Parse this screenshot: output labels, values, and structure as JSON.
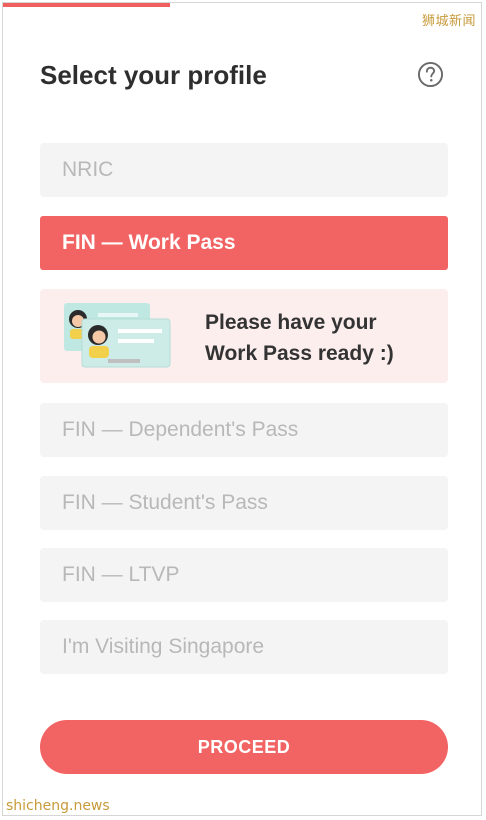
{
  "progress_fraction": 0.35,
  "watermark": {
    "top": "狮城新闻",
    "bottom": "shicheng.news"
  },
  "header": {
    "title": "Select your profile",
    "help_icon": "question-circle-icon"
  },
  "options": [
    {
      "label": "NRIC",
      "selected": false
    },
    {
      "label": "FIN — Work Pass",
      "selected": true
    },
    {
      "label": "FIN — Dependent's Pass",
      "selected": false
    },
    {
      "label": "FIN — Student's Pass",
      "selected": false
    },
    {
      "label": "FIN — LTVP",
      "selected": false
    },
    {
      "label": "I'm Visiting Singapore",
      "selected": false
    }
  ],
  "info_card": {
    "line1": "Please have your",
    "line2": "Work Pass ready :)",
    "icon": "id-cards-illustration"
  },
  "proceed_label": "PROCEED",
  "colors": {
    "accent": "#f26463",
    "info_bg": "#fdeeee",
    "option_bg": "#f4f4f4"
  }
}
